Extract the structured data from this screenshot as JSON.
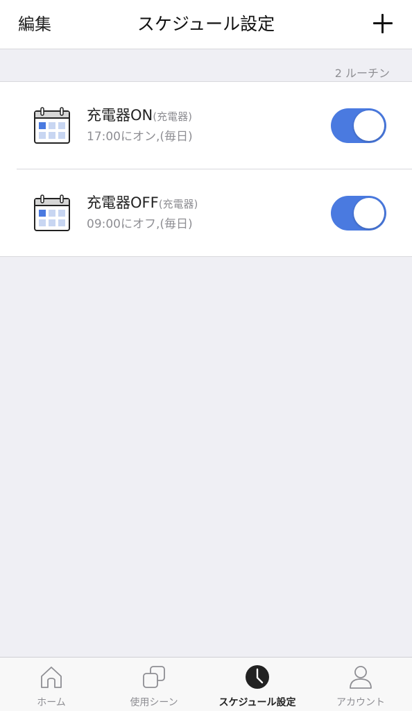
{
  "navbar": {
    "edit_label": "編集",
    "title": "スケジュール設定",
    "add_icon": "plus-icon"
  },
  "routine_count": "2 ルーチン",
  "routines": [
    {
      "name": "充電器ON",
      "device": "(充電器)",
      "schedule": "17:00にオン,(毎日)",
      "enabled": true,
      "icon": "calendar-icon"
    },
    {
      "name": "充電器OFF",
      "device": "(充電器)",
      "schedule": "09:00にオフ,(毎日)",
      "enabled": true,
      "icon": "calendar-icon"
    }
  ],
  "tabs": [
    {
      "label": "ホーム",
      "icon": "home-icon",
      "active": false
    },
    {
      "label": "使用シーン",
      "icon": "scenes-icon",
      "active": false
    },
    {
      "label": "スケジュール設定",
      "icon": "clock-icon",
      "active": true
    },
    {
      "label": "アカウント",
      "icon": "account-icon",
      "active": false
    }
  ],
  "colors": {
    "toggle_on": "#4a7ae0",
    "background": "#efeff4",
    "secondary_text": "#8e8e93"
  }
}
